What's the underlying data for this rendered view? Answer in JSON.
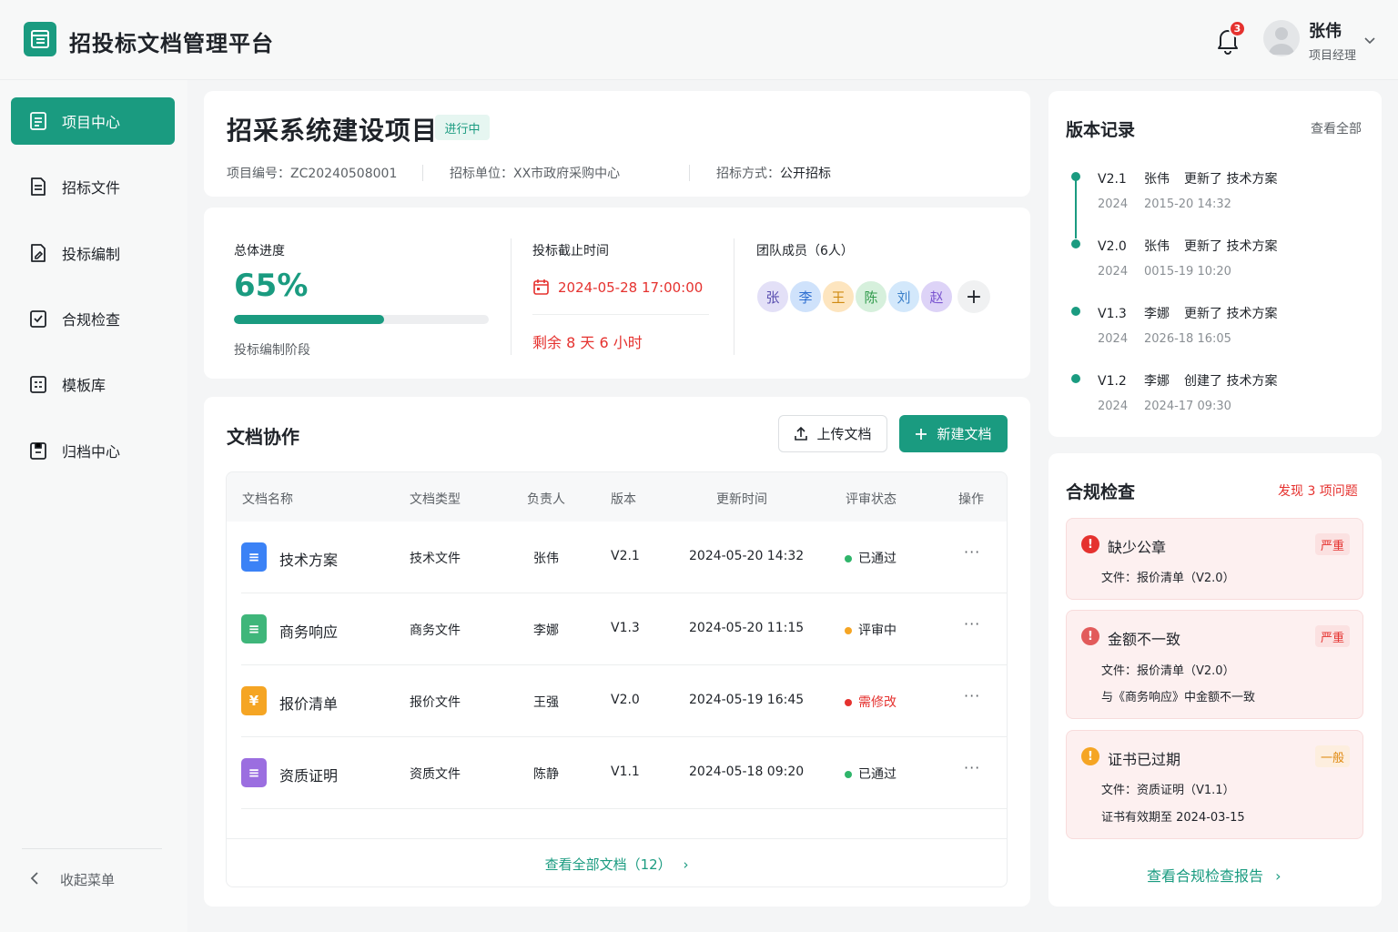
{
  "app": {
    "title": "招投标文档管理平台"
  },
  "header": {
    "notification_count": "3",
    "user_name": "张伟",
    "user_role": "项目经理"
  },
  "sidebar": {
    "items": [
      {
        "label": "项目中心",
        "icon": "project-icon",
        "active": true
      },
      {
        "label": "招标文件",
        "icon": "tender-doc-icon"
      },
      {
        "label": "投标编制",
        "icon": "bid-edit-icon"
      },
      {
        "label": "合规检查",
        "icon": "compliance-icon"
      },
      {
        "label": "模板库",
        "icon": "template-icon"
      },
      {
        "label": "归档中心",
        "icon": "archive-icon"
      }
    ],
    "collapse_label": "收起菜单"
  },
  "project": {
    "title": "招采系统建设项目",
    "status": "进行中",
    "code_label": "项目编号：",
    "code": "ZC20240508001",
    "org_label": "招标单位：",
    "org": "XX市政府采购中心",
    "method_label": "招标方式：",
    "method": "公开招标"
  },
  "stats": {
    "progress_label": "总体进度",
    "progress_value": "65%",
    "progress_fraction": 0.59,
    "stage": "投标编制阶段",
    "deadline_label": "投标截止时间",
    "deadline": "2024-05-28 17:00:00",
    "remaining": "剩余 8 天 6 小时",
    "team_label": "团队成员（6人）",
    "members": [
      {
        "initial": "张",
        "bg": "#e3e0f7",
        "fg": "#5a4fb0"
      },
      {
        "initial": "李",
        "bg": "#cfe2fb",
        "fg": "#2f6fd0"
      },
      {
        "initial": "王",
        "bg": "#fde5bf",
        "fg": "#d08a10"
      },
      {
        "initial": "陈",
        "bg": "#d6f0dc",
        "fg": "#2f9a4a"
      },
      {
        "initial": "刘",
        "bg": "#d3e8fb",
        "fg": "#3a7fc9"
      },
      {
        "initial": "赵",
        "bg": "#ddd3f7",
        "fg": "#7a55d0"
      }
    ],
    "add_member": "+"
  },
  "docs": {
    "title": "文档协作",
    "upload_label": "上传文档",
    "new_label": "新建文档",
    "columns": [
      "文档名称",
      "文档类型",
      "负责人",
      "版本",
      "更新时间",
      "评审状态",
      "操作"
    ],
    "rows": [
      {
        "name": "技术方案",
        "type": "技术文件",
        "owner": "张伟",
        "version": "V2.1",
        "updated": "2024-05-20 14:32",
        "status": "已通过",
        "status_color": "#2fb56a",
        "icon_color": "#3b82f6",
        "icon_glyph": "≡"
      },
      {
        "name": "商务响应",
        "type": "商务文件",
        "owner": "李娜",
        "version": "V1.3",
        "updated": "2024-05-20 11:15",
        "status": "评审中",
        "status_color": "#f5a524",
        "icon_color": "#3fb67a",
        "icon_glyph": "≡"
      },
      {
        "name": "报价清单",
        "type": "报价文件",
        "owner": "王强",
        "version": "V2.0",
        "updated": "2024-05-19 16:45",
        "status": "需修改",
        "status_color": "#e5322f",
        "icon_color": "#f5a524",
        "icon_glyph": "¥"
      },
      {
        "name": "资质证明",
        "type": "资质文件",
        "owner": "陈静",
        "version": "V1.1",
        "updated": "2024-05-18 09:20",
        "status": "已通过",
        "status_color": "#2fb56a",
        "icon_color": "#9b6ee0",
        "icon_glyph": "≡"
      }
    ],
    "more": "···",
    "view_all": "查看全部文档（12）"
  },
  "versions": {
    "title": "版本记录",
    "view_all": "查看全部",
    "items": [
      {
        "version": "V2.1",
        "user": "张伟",
        "action": "更新了 技术方案",
        "year": "2024",
        "time": "2015-20 14:32"
      },
      {
        "version": "V2.0",
        "user": "张伟",
        "action": "更新了 技术方案",
        "year": "2024",
        "time": "0015-19 10:20"
      },
      {
        "version": "V1.3",
        "user": "李娜",
        "action": "更新了 技术方案",
        "year": "2024",
        "time": "2026-18 16:05"
      },
      {
        "version": "V1.2",
        "user": "李娜",
        "action": "创建了 技术方案",
        "year": "2024",
        "time": "2024-17 09:30"
      }
    ]
  },
  "compliance": {
    "title": "合规检查",
    "found": "发现 3 项问题",
    "issues": [
      {
        "title": "缺少公章",
        "level": "严重",
        "icon_color": "#e5322f",
        "lines": [
          "文件：报价清单（V2.0）"
        ]
      },
      {
        "title": "金额不一致",
        "level": "严重",
        "icon_color": "#e25b5b",
        "lines": [
          "文件：报价清单（V2.0）",
          "与《商务响应》中金额不一致"
        ]
      },
      {
        "title": "证书已过期",
        "level": "一般",
        "icon_color": "#f5a524",
        "lines": [
          "文件：资质证明（V1.1）",
          "证书有效期至 2024-03-15"
        ]
      }
    ],
    "report_link": "查看合规检查报告"
  },
  "colors": {
    "accent": "#1a9b80",
    "danger": "#e5322f",
    "warning": "#f5a524"
  }
}
